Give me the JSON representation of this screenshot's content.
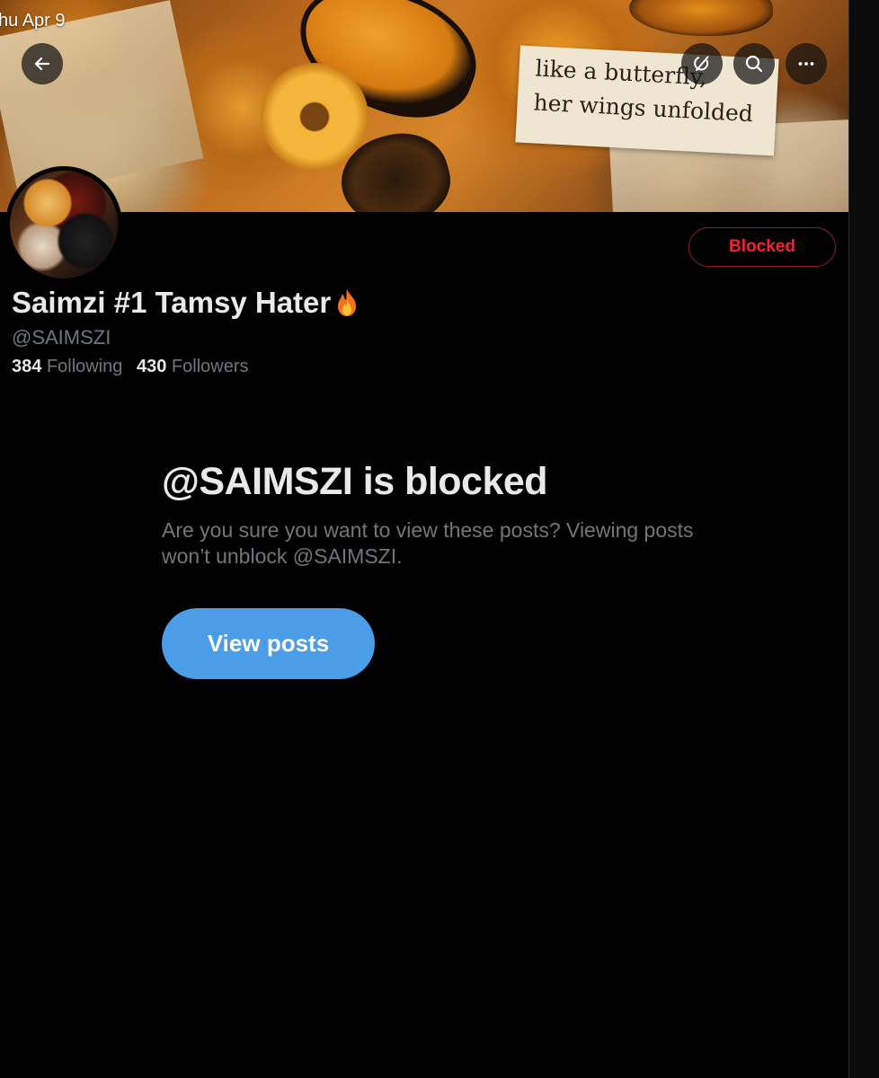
{
  "status_bar": {
    "time": "hu Apr 9"
  },
  "header": {
    "back_icon": "arrow-left-icon",
    "grok_icon": "grok-icon",
    "search_icon": "search-icon",
    "more_icon": "more-horizontal-icon"
  },
  "banner": {
    "quote_line1": "like a butterfly,",
    "quote_line2": "her wings unfolded"
  },
  "profile": {
    "display_name": "Saimzi #1 Tamsy Hater",
    "name_emoji": "fire-emoji",
    "handle": "@SAIMSZI",
    "following_count": "384",
    "following_label": "Following",
    "followers_count": "430",
    "followers_label": "Followers",
    "blocked_button_label": "Blocked",
    "blocked_color": "#f4212e"
  },
  "blocked_notice": {
    "title": "@SAIMSZI is blocked",
    "message": "Are you sure you want to view these posts? Viewing posts won’t unblock @SAIMSZI.",
    "view_posts_label": "View posts",
    "button_color": "#4a9de6"
  }
}
